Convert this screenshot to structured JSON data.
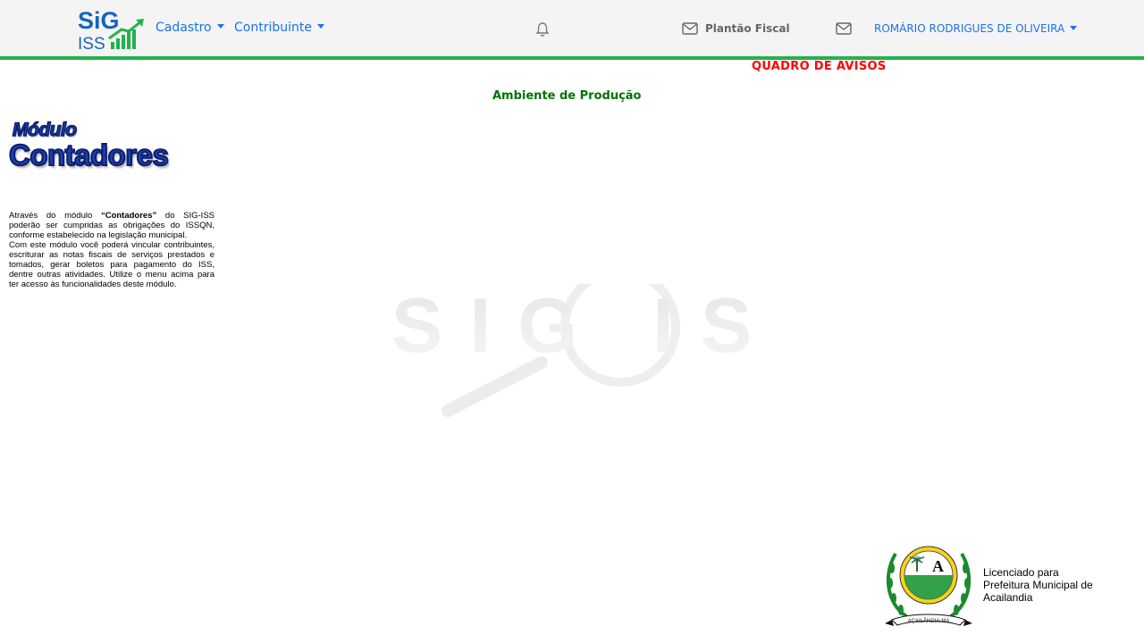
{
  "header": {
    "logo_text_top": "SiG",
    "logo_text_bottom": "ISS",
    "menus": [
      {
        "label": "Cadastro"
      },
      {
        "label": "Contribuinte"
      }
    ],
    "plantao_label": "Plantão Fiscal",
    "user_name": "ROMÁRIO RODRIGUES DE OLIVEIRA",
    "accent_color": "#22b24c",
    "link_color": "#1a73e8"
  },
  "notice": {
    "title": "QUADRO DE AVISOS",
    "environment": "Ambiente de Produção"
  },
  "module": {
    "line1": "Módulo",
    "line2": "Contadores",
    "intro_prefix": "Através do módulo ",
    "intro_bold": "“Contadores”",
    "intro_suffix": " do SIG-ISS poderão ser cumpridas as obrigações do ISSQN, conforme estabelecido na legislação municipal.",
    "paragraph2": "Com este módulo você poderá vincular contribuintes, escriturar as notas fiscais de serviços prestados e tomados, gerar boletos para pagamento do ISS, dentre outras atividades. Utilize o menu acima para ter acesso às funcionalidades deste módulo."
  },
  "watermark": {
    "text": "SIG ISS"
  },
  "footer": {
    "seal_text": "AÇAILÂNDIA-MA",
    "license_text": "Licenciado para Prefeitura Municipal de Acailandia"
  },
  "icons": {
    "bell": "bell-icon",
    "mail": "envelope-icon"
  }
}
